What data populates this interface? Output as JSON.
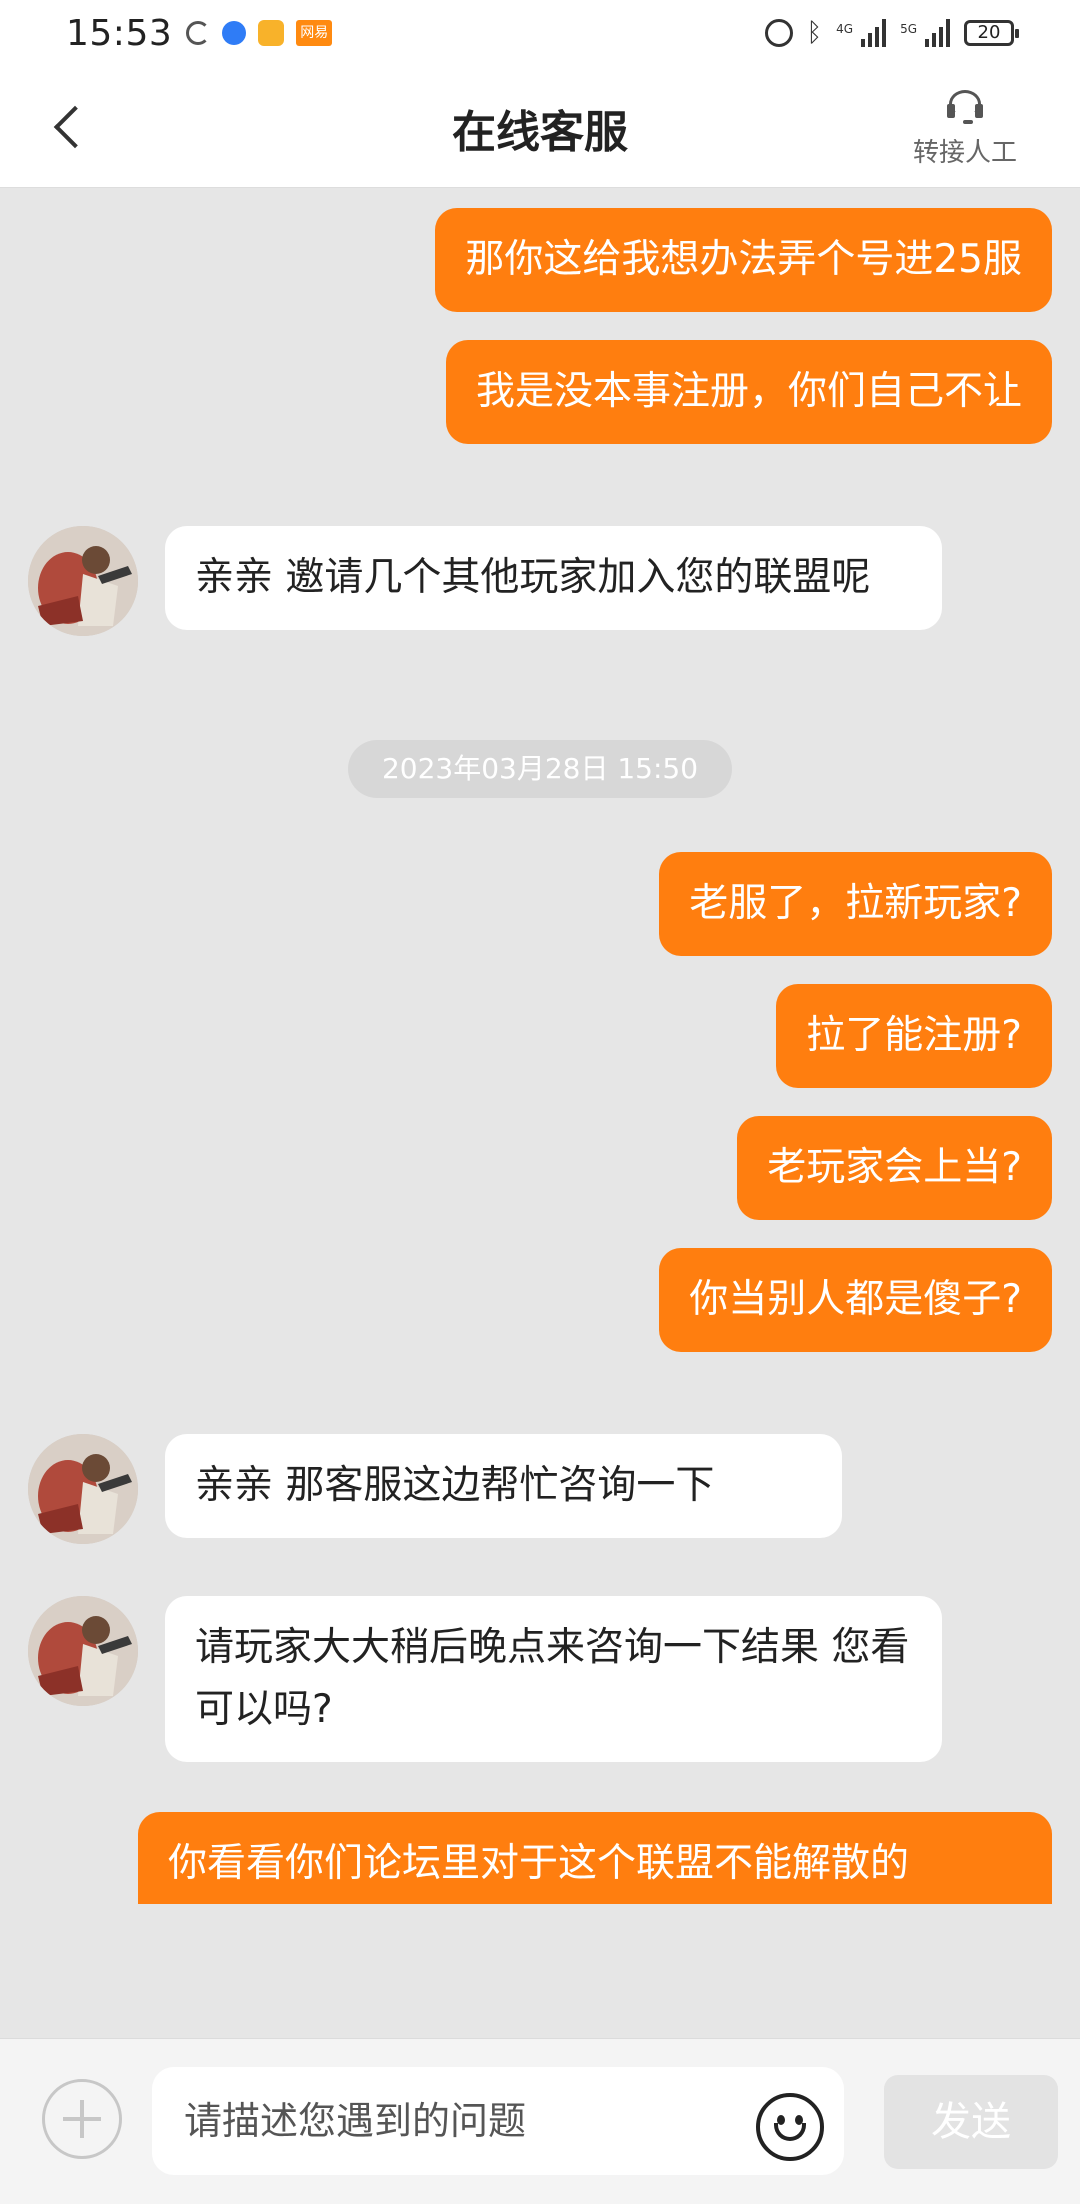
{
  "status_bar": {
    "time": "15:53",
    "app_tag": "网易",
    "net1": "4G",
    "net2": "5G",
    "battery": "20"
  },
  "header": {
    "title": "在线客服",
    "transfer_label": "转接人工"
  },
  "messages": [
    {
      "side": "out",
      "text": "那你这给我想办法弄个号进25服"
    },
    {
      "side": "out",
      "text": "我是没本事注册，你们自己不让"
    },
    {
      "side": "in",
      "text": "亲亲 邀请几个其他玩家加入您的联盟呢"
    },
    {
      "side": "time",
      "text": "2023年03月28日 15:50"
    },
    {
      "side": "out",
      "text": "老服了，拉新玩家?"
    },
    {
      "side": "out",
      "text": "拉了能注册?"
    },
    {
      "side": "out",
      "text": "老玩家会上当?"
    },
    {
      "side": "out",
      "text": "你当别人都是傻子?"
    },
    {
      "side": "in",
      "text": "亲亲  那客服这边帮忙咨询一下"
    },
    {
      "side": "in",
      "text": "请玩家大大稍后晚点来咨询一下结果 您看可以吗?"
    },
    {
      "side": "out",
      "text": "你看看你们论坛里对于这个联盟不能解散的"
    }
  ],
  "input": {
    "placeholder": "请描述您遇到的问题",
    "send_label": "发送"
  },
  "colors": {
    "accent": "#ff7e0f",
    "background": "#e6e6e6"
  },
  "icons": {
    "back": "chevron-left-icon",
    "transfer": "headset-icon",
    "add": "plus-icon",
    "emoji": "smiley-icon"
  }
}
